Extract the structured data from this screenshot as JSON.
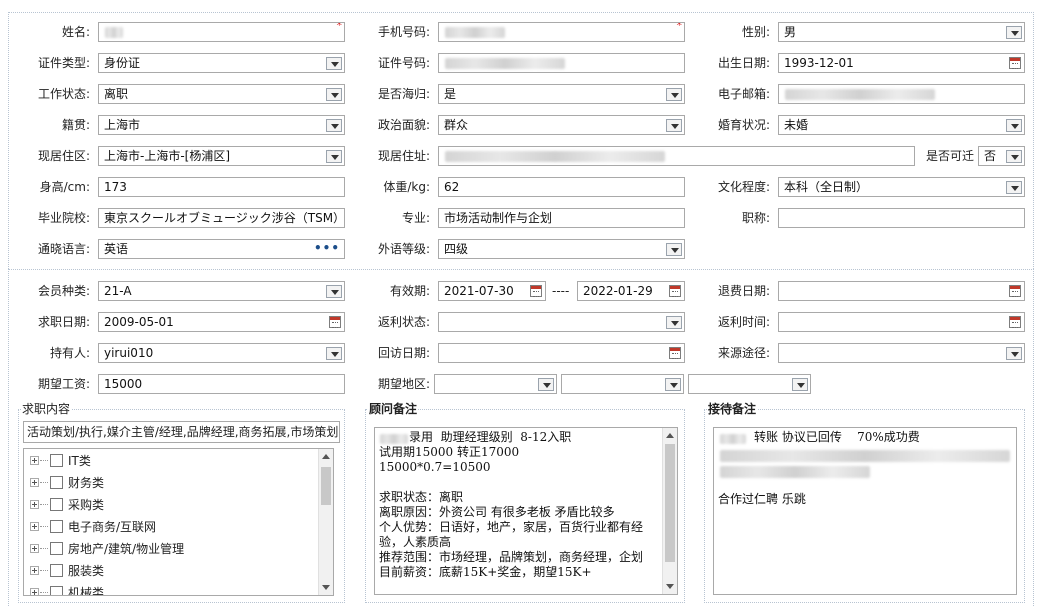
{
  "personal": {
    "name": {
      "label": "姓名:",
      "required_mark": "*"
    },
    "mobile": {
      "label": "手机号码:",
      "required_mark": "*"
    },
    "gender": {
      "label": "性别:",
      "value": "男"
    },
    "id_type": {
      "label": "证件类型:",
      "value": "身份证"
    },
    "id_number": {
      "label": "证件号码:"
    },
    "birth_date": {
      "label": "出生日期:",
      "value": "1993-12-01"
    },
    "work_status": {
      "label": "工作状态:",
      "value": "离职"
    },
    "returnee": {
      "label": "是否海归:",
      "value": "是"
    },
    "email": {
      "label": "电子邮箱:"
    },
    "native_place": {
      "label": "籍贯:",
      "value": "上海市"
    },
    "political_status": {
      "label": "政治面貌:",
      "value": "群众"
    },
    "marital_status": {
      "label": "婚育状况:",
      "value": "未婚"
    },
    "current_region": {
      "label": "现居住区:",
      "value": "上海市-上海市-[杨浦区]"
    },
    "current_address": {
      "label": "现居住址:"
    },
    "relocate": {
      "label": "是否可迁",
      "value": "否"
    },
    "height": {
      "label": "身高/cm:",
      "value": "173"
    },
    "weight": {
      "label": "体重/kg:",
      "value": "62"
    },
    "education": {
      "label": "文化程度:",
      "value": "本科（全日制）"
    },
    "school": {
      "label": "毕业院校:",
      "value": "東京スクールオブミュージック涉谷（TSM）"
    },
    "major": {
      "label": "专业:",
      "value": "市场活动制作与企划"
    },
    "title": {
      "label": "职称:",
      "value": ""
    },
    "language": {
      "label": "通晓语言:",
      "value": "英语",
      "more": "•••"
    },
    "foreign_level": {
      "label": "外语等级:",
      "value": "四级"
    }
  },
  "membership": {
    "member_type": {
      "label": "会员种类:",
      "value": "21-A"
    },
    "valid_period": {
      "label": "有效期:",
      "from": "2021-07-30",
      "to": "2022-01-29",
      "separator": "----"
    },
    "refund_date": {
      "label": "退费日期:",
      "value": ""
    },
    "job_date": {
      "label": "求职日期:",
      "value": "2009-05-01"
    },
    "rebate_status": {
      "label": "返利状态:",
      "value": ""
    },
    "rebate_time": {
      "label": "返利时间:",
      "value": ""
    },
    "holder": {
      "label": "持有人:",
      "value": "yirui010"
    },
    "visit_date": {
      "label": "回访日期:",
      "value": ""
    },
    "source": {
      "label": "来源途径:",
      "value": ""
    },
    "expected_salary": {
      "label": "期望工资:",
      "value": "15000"
    },
    "expected_region": {
      "label": "期望地区:"
    }
  },
  "job_content": {
    "title": "求职内容",
    "summary": "活动策划/执行,媒介主管/经理,品牌经理,商务拓展,市场策划",
    "tree": [
      "IT类",
      "财务类",
      "采购类",
      "电子商务/互联网",
      "房地产/建筑/物业管理",
      "服装类",
      "机械类"
    ]
  },
  "consultant_note": {
    "title": "顾问备注",
    "text": "录用  助理经理级别  8-12入职\n试用期15000 转正17000\n15000*0.7=10500\n\n求职状态：离职\n离职原因：外资公司 有很多老板 矛盾比较多\n个人优势：日语好，地产，家居，百货行业都有经验，人素质高\n推荐范围：市场经理，品牌策划，商务经理，企划\n目前薪资：底薪15K+奖金，期望15K+"
  },
  "reception_note": {
    "title": "接待备注",
    "line1": "转账 协议已回传    70%成功费",
    "line2": "合作过仁聘 乐跳"
  }
}
